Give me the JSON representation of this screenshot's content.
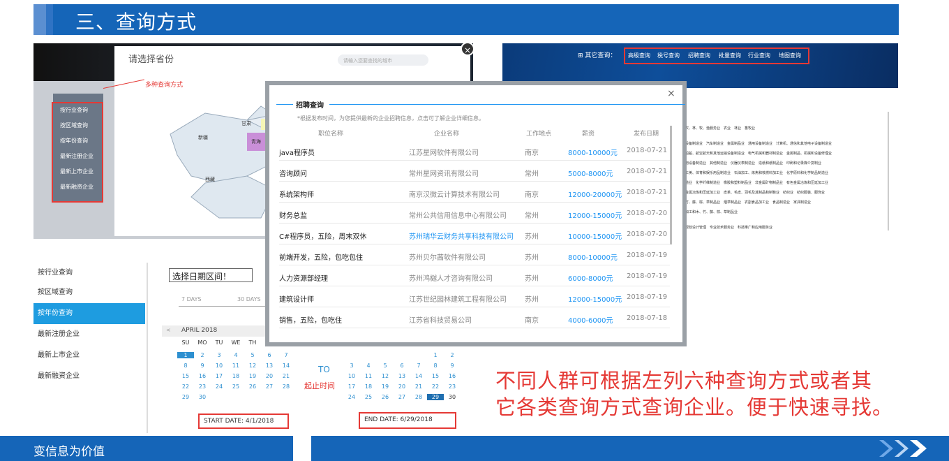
{
  "title": "三、查询方式",
  "panel1": {
    "modal_title": "请选择省份",
    "search_placeholder": "请输入您要查找的城市",
    "annotation": "多种查询方式",
    "sidebar": [
      "按行业查询",
      "按区域查询",
      "按年份查询",
      "最新注册企业",
      "最新上市企业",
      "最新融资企业"
    ],
    "provinces": [
      "新疆",
      "甘肃",
      "青海",
      "西藏"
    ]
  },
  "panel2": {
    "other_label": "其它查询：",
    "nav": [
      "高级查询",
      "税号查询",
      "招聘查询",
      "批量查询",
      "行业查询",
      "地图查询"
    ],
    "rows": [
      "农、林、牧、渔服务业　农业　林业　畜牧业",
      "设备制造业　汽车制造业　金属制品业　通用设备制造业　计算机、通信和其他电子设备制造业",
      "船舶、航空航天和其他运输设备制造业　电气机械和器材制造业　金属制品、机械和设备修理业",
      "用设备制造业　其他制造业　仪器仪表制造业　造纸和纸制品业　印刷和记录媒介复制业",
      "工美、体育和娱乐用品制造业　石油加工、炼焦和核燃料加工业　化学原料和化学制品制造业",
      "造业　化学纤维制造业　橡胶和塑料制品业　非金属矿物制品业　有色金属冶炼和压延加工业",
      "金属冶炼和压延加工业　皮革、毛皮、羽毛及其制品和制鞋业　纺织业　纺织服装、服饰业",
      "竹、藤、棕、草制品业　烟草制品业　农副食品加工业　食品制造业　家具制造业",
      "加工和木、竹、藤、棕、草制品业",
      "规划设计管理　专业技术服务业　科技推广和应用服务业"
    ]
  },
  "modal": {
    "title": "招聘查询",
    "close": "×",
    "note": "*根据发布时间，为您提供最新的企业招聘信息，点击可了解企业详细信息。",
    "headers": [
      "职位名称",
      "企业名称",
      "工作地点",
      "薪资",
      "发布日期"
    ],
    "rows": [
      {
        "job": "java程序员",
        "company": "江苏星网软件有限公司",
        "city": "南京",
        "salary": "8000-10000元",
        "date": "2018-07-21"
      },
      {
        "job": "咨询顾问",
        "company": "常州星网资讯有限公司",
        "city": "常州",
        "salary": "5000-8000元",
        "date": "2018-07-21"
      },
      {
        "job": "系统架构师",
        "company": "南京汉微云计算技术有限公司",
        "city": "南京",
        "salary": "12000-20000元",
        "date": "2018-07-21"
      },
      {
        "job": "财务总监",
        "company": "常州公共信用信息中心有限公司",
        "city": "常州",
        "salary": "12000-15000元",
        "date": "2018-07-20"
      },
      {
        "job": "C#程序员，五险，周末双休",
        "company": "苏州瑞华云财务共享科技有限公司",
        "city": "苏州",
        "salary": "10000-15000元",
        "date": "2018-07-20"
      },
      {
        "job": "前端开发，五险，包吃包住",
        "company": "苏州贝尔茜软件有限公司",
        "city": "苏州",
        "salary": "8000-10000元",
        "date": "2018-07-19"
      },
      {
        "job": "人力资源部经理",
        "company": "苏州鸿樾人才咨询有限公司",
        "city": "苏州",
        "salary": "6000-8000元",
        "date": "2018-07-19"
      },
      {
        "job": "建筑设计师",
        "company": "江苏世纪园林建筑工程有限公司",
        "city": "苏州",
        "salary": "12000-15000元",
        "date": "2018-07-19"
      },
      {
        "job": "销售，五险，包吃住",
        "company": "江苏省科技贸易公司",
        "city": "南京",
        "salary": "4000-6000元",
        "date": "2018-07-18"
      }
    ]
  },
  "panel3": {
    "sidebar": [
      "按行业查询",
      "按区域查询",
      "按年份查询",
      "最新注册企业",
      "最新上市企业",
      "最新融资企业"
    ],
    "active": "按年份查询",
    "date_title": "选择日期区间！",
    "ranges": [
      "7 DAYS",
      "30 DAYS"
    ],
    "month": "APRIL 2018",
    "weekdays": [
      "SU",
      "MO",
      "TU",
      "WE",
      "TH"
    ],
    "weeks": [
      [
        "1",
        "2",
        "3",
        "4",
        "5",
        "6",
        "7"
      ],
      [
        "8",
        "9",
        "10",
        "11",
        "12",
        "13",
        "14"
      ],
      [
        "15",
        "16",
        "17",
        "18",
        "19",
        "20",
        "21"
      ],
      [
        "22",
        "23",
        "24",
        "25",
        "26",
        "27",
        "28"
      ],
      [
        "29",
        "30"
      ]
    ],
    "to": "TO",
    "range_label": "起止时间",
    "right_weeks": [
      [
        "1",
        "2"
      ],
      [
        "3",
        "4",
        "5",
        "6",
        "7",
        "8",
        "9"
      ],
      [
        "10",
        "11",
        "12",
        "13",
        "14",
        "15",
        "16"
      ],
      [
        "17",
        "18",
        "19",
        "20",
        "21",
        "22",
        "23"
      ],
      [
        "24",
        "25",
        "26",
        "27",
        "28",
        "29",
        "30"
      ]
    ],
    "start": "START DATE: 4/1/2018",
    "end": "END DATE: 6/29/2018"
  },
  "caption_line1": "不同人群可根据左列六种查询方式或者其",
  "caption_line2": "它各类查询方式查询企业。便于快速寻找。",
  "footer": "变信息为价值"
}
